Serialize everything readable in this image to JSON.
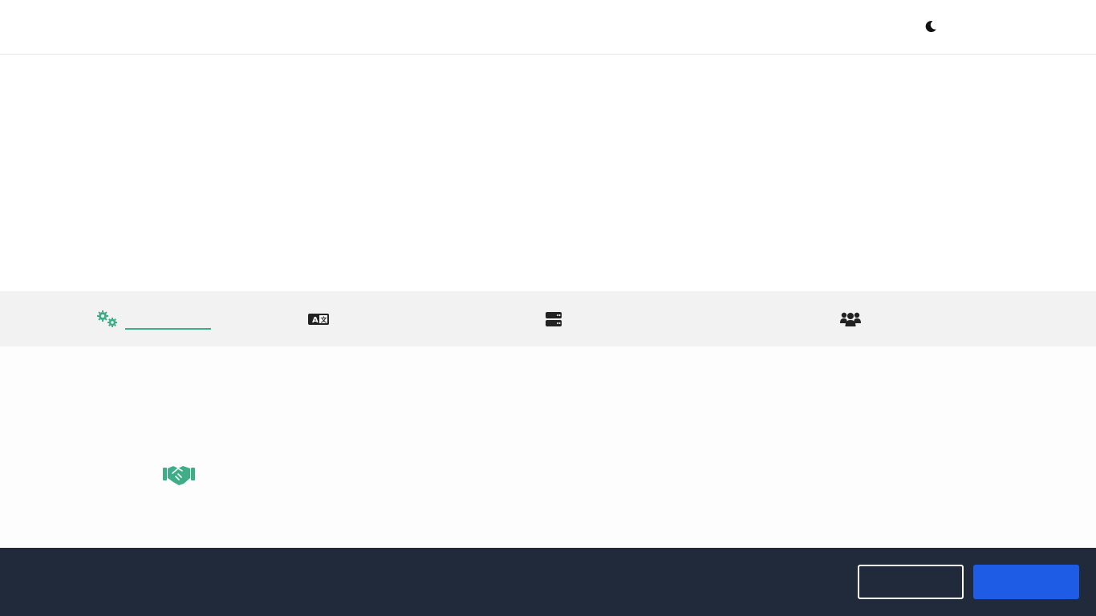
{
  "header": {
    "theme_toggle_icon": "moon-icon"
  },
  "tabs": [
    {
      "icon": "gears-icon",
      "label": "",
      "active": true
    },
    {
      "icon": "translate-icon",
      "label": "",
      "active": false
    },
    {
      "icon": "server-icon",
      "label": "",
      "active": false
    },
    {
      "icon": "users-icon",
      "label": "",
      "active": false
    }
  ],
  "content": {
    "icon": "handshake-icon"
  },
  "footer": {
    "secondary_button_label": "",
    "primary_button_label": ""
  },
  "colors": {
    "accent": "#3fae88",
    "primary_button": "#1f5ce6",
    "footer_background": "#202a3a",
    "tab_bar_background": "#f2f2f2"
  }
}
